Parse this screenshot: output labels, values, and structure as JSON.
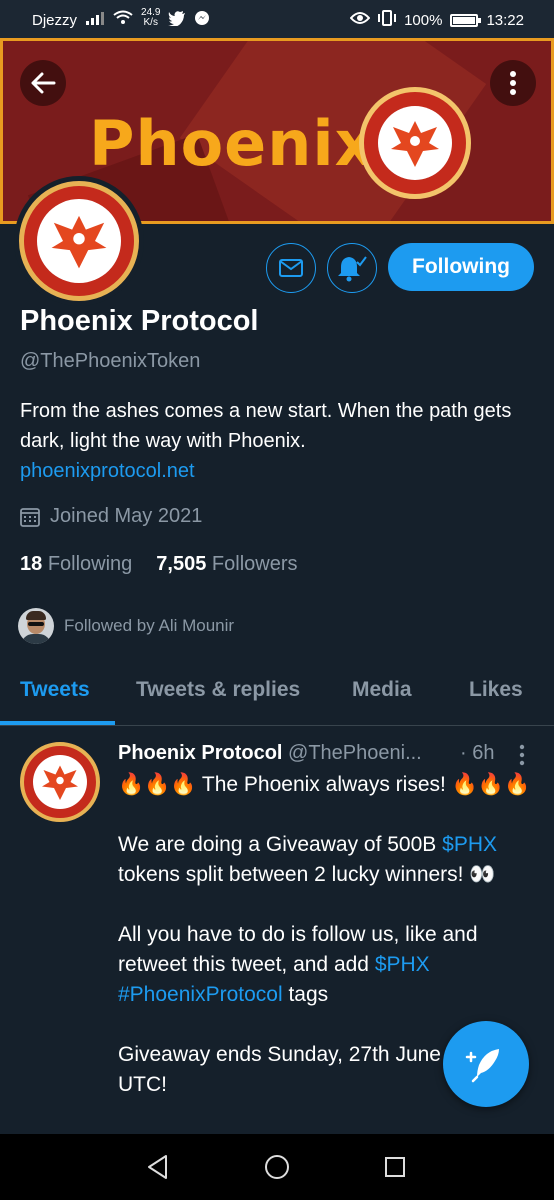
{
  "status_bar": {
    "carrier": "Djezzy",
    "net_speed_value": "24.9",
    "net_speed_unit": "K/s",
    "battery_percent": "100%",
    "battery_level": 1.0,
    "time": "13:22"
  },
  "banner": {
    "title": "Phoenix",
    "colors": {
      "background": "#7a1c1c",
      "border": "#e89b20",
      "title": "#f7a81b"
    }
  },
  "profile": {
    "name": "Phoenix Protocol",
    "handle": "@ThePhoenixToken",
    "bio": "From the ashes comes a new start. When the path gets dark, light the way with Phoenix.",
    "website": "phoenixprotocol.net",
    "joined": "Joined May 2021",
    "following_count": "18",
    "following_label": "Following",
    "followers_count": "7,505",
    "followers_label": "Followers",
    "followed_by": "Followed by Ali Mounir",
    "follow_button_label": "Following"
  },
  "tabs": [
    {
      "label": "Tweets",
      "active": true
    },
    {
      "label": "Tweets & replies",
      "active": false
    },
    {
      "label": "Media",
      "active": false
    },
    {
      "label": "Likes",
      "active": false
    }
  ],
  "tweet": {
    "author_name": "Phoenix Protocol",
    "author_handle": "@ThePhoeni...",
    "time": "· 6h",
    "line1": "🔥🔥🔥 The Phoenix always rises! 🔥🔥🔥",
    "p2_a": "We are doing a Giveaway of 500B ",
    "p2_tag": "$PHX",
    "p2_b": " tokens split between 2 lucky winners! 👀",
    "p3_a": "All you have to do is follow us, like and retweet this tweet, and add ",
    "p3_tag1": "$PHX",
    "p3_tag2": "#PhoenixProtocol",
    "p3_b": " tags",
    "p4": "Giveaway ends Sunday, 27th June 2021 UTC!"
  },
  "colors": {
    "accent": "#1d9bf0",
    "background": "#15202b",
    "muted": "#8b98a5"
  }
}
